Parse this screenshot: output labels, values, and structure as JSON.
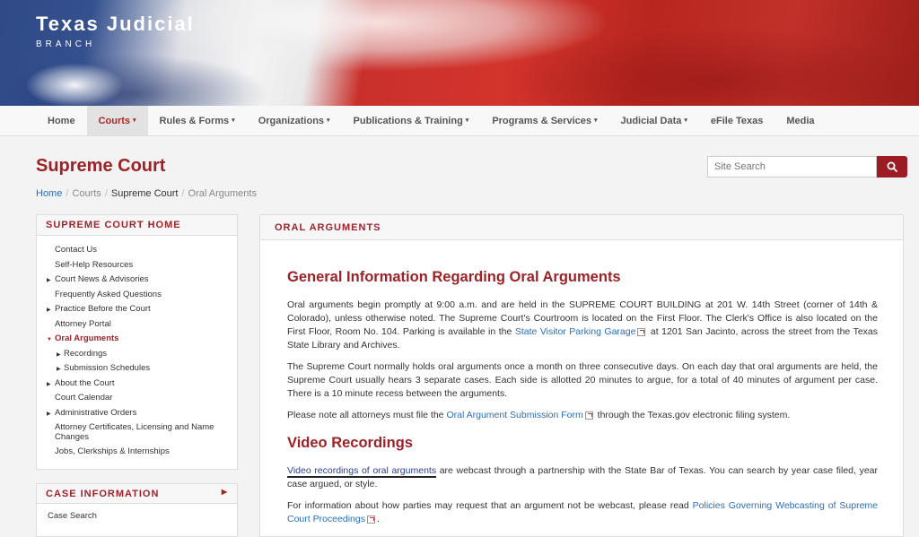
{
  "header": {
    "logo_line1": "Texas Judicial",
    "logo_line2": "BRANCH"
  },
  "nav": {
    "items": [
      {
        "label": "Home"
      },
      {
        "label": "Courts"
      },
      {
        "label": "Rules & Forms"
      },
      {
        "label": "Organizations"
      },
      {
        "label": "Publications & Training"
      },
      {
        "label": "Programs & Services"
      },
      {
        "label": "Judicial Data"
      },
      {
        "label": "eFile Texas"
      },
      {
        "label": "Media"
      }
    ],
    "dropdown_caret": "▾"
  },
  "page": {
    "title": "Supreme Court"
  },
  "search": {
    "placeholder": "Site Search"
  },
  "breadcrumb": {
    "home": "Home",
    "courts": "Courts",
    "supreme": "Supreme Court",
    "current": "Oral Arguments",
    "sep": "/"
  },
  "sidebar": {
    "title": "SUPREME COURT HOME",
    "items": [
      {
        "label": "Contact Us"
      },
      {
        "label": "Self-Help Resources"
      },
      {
        "label": "Court News & Advisories"
      },
      {
        "label": "Frequently Asked Questions"
      },
      {
        "label": "Practice Before the Court"
      },
      {
        "label": "Attorney Portal"
      },
      {
        "label": "Oral Arguments"
      },
      {
        "label": "Recordings"
      },
      {
        "label": "Submission Schedules"
      },
      {
        "label": "About the Court"
      },
      {
        "label": "Court Calendar"
      },
      {
        "label": "Administrative Orders"
      },
      {
        "label": "Attorney Certificates, Licensing and Name Changes"
      },
      {
        "label": "Jobs, Clerkships & Internships"
      }
    ]
  },
  "sidebar2": {
    "title": "CASE INFORMATION",
    "items": [
      {
        "label": "Case Search"
      }
    ]
  },
  "main": {
    "panel_title": "ORAL ARGUMENTS",
    "h1": "General Information Regarding Oral Arguments",
    "p1_a": "Oral arguments begin promptly at 9:00 a.m. and are held in the SUPREME COURT BUILDING at 201 W. 14th Street (corner of 14th & Colorado), unless otherwise noted. The Supreme Court's Courtroom is located on the First Floor. The Clerk's Office is also located on the First Floor, Room No. 104. Parking is available in the ",
    "p1_link": "State Visitor Parking Garage",
    "p1_b": " at 1201 San Jacinto, across the street from the Texas State Library and Archives.",
    "p2": "The Supreme Court normally holds oral arguments once a month on three consecutive days. On each day that oral arguments are held, the Supreme Court usually hears 3 separate cases. Each side is allotted 20 minutes to argue, for a total of 40 minutes of argument per case. There is a 10 minute recess between the arguments.",
    "p3_a": "Please note all attorneys must file the ",
    "p3_link": "Oral Argument Submission Form",
    "p3_b": " through the Texas.gov electronic filing system.",
    "h2": "Video Recordings",
    "p4_link": "Video recordings of oral arguments",
    "p4_b": " are webcast through a partnership with the State Bar of Texas. You can search by year case filed, year case argued, or style.",
    "p5_a": "For information about how parties may request that an argument not be webcast, please read ",
    "p5_link": "Policies Governing Webcasting of Supreme Court Proceedings",
    "p5_b": "."
  }
}
